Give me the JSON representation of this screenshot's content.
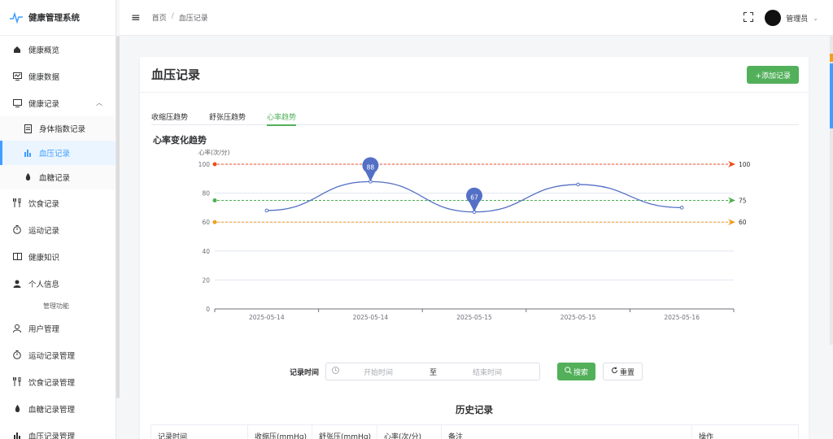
{
  "app": {
    "title": "健康管理系统"
  },
  "sidebar": {
    "items": [
      {
        "label": "健康概览",
        "icon": "home-icon"
      },
      {
        "label": "健康数据",
        "icon": "data-icon"
      },
      {
        "label": "健康记录",
        "icon": "record-icon"
      },
      {
        "label": "身体指数记录",
        "icon": "document-icon"
      },
      {
        "label": "血压记录",
        "icon": "bar-chart-icon"
      },
      {
        "label": "血糖记录",
        "icon": "drop-icon"
      },
      {
        "label": "饮食记录",
        "icon": "fork-icon"
      },
      {
        "label": "运动记录",
        "icon": "timer-icon"
      },
      {
        "label": "健康知识",
        "icon": "book-icon"
      },
      {
        "label": "个人信息",
        "icon": "person-icon"
      },
      {
        "label": "管理功能"
      },
      {
        "label": "用户管理",
        "icon": "user-icon"
      },
      {
        "label": "运动记录管理",
        "icon": "timer-icon"
      },
      {
        "label": "饮食记录管理",
        "icon": "fork-icon"
      },
      {
        "label": "血糖记录管理",
        "icon": "drop-icon"
      },
      {
        "label": "血压记录管理",
        "icon": "bar-chart-icon"
      }
    ]
  },
  "header": {
    "breadcrumb": [
      "首页",
      "/",
      "血压记录"
    ],
    "user_name": "管理员"
  },
  "page": {
    "title": "血压记录",
    "add_button": "+添加记录",
    "tabs": [
      "收缩压趋势",
      "舒张压趋势",
      "心率趋势"
    ],
    "active_tab": 2,
    "chart_heading": "心率变化趋势"
  },
  "search": {
    "label": "记录时间",
    "start_placeholder": "开始时间",
    "to": "至",
    "end_placeholder": "结束时间",
    "search_button": "搜索",
    "reset_button": "重置"
  },
  "history": {
    "title": "历史记录",
    "columns": [
      "记录时间",
      "收缩压(mmHg)",
      "舒张压(mmHg)",
      "心率(次/分)",
      "备注",
      "操作"
    ]
  },
  "chart_data": {
    "type": "line",
    "ylabel": "心率(次/分)",
    "ylim": [
      0,
      100
    ],
    "yticks": [
      0,
      20,
      40,
      60,
      80,
      100
    ],
    "categories": [
      "2025-05-14",
      "2025-05-14",
      "2025-05-15",
      "2025-05-15",
      "2025-05-16"
    ],
    "series": [
      {
        "values": [
          68,
          88,
          67,
          86,
          70
        ],
        "color": "#5470c6",
        "smooth": true
      }
    ],
    "markpoints": [
      {
        "label": "88",
        "index": 1
      },
      {
        "label": "67",
        "index": 2
      }
    ],
    "reference_lines": [
      {
        "value": 100,
        "label": "100",
        "color": "#ee4c1c"
      },
      {
        "value": 75,
        "label": "75",
        "color": "#4caf50"
      },
      {
        "value": 60,
        "label": "60",
        "color": "#f0a020"
      }
    ]
  }
}
